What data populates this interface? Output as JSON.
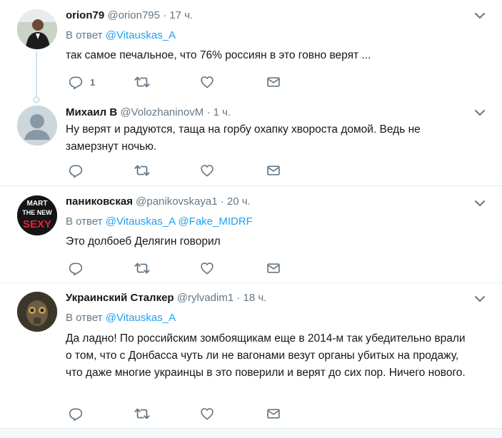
{
  "tweets": [
    {
      "name": "orion79",
      "handle": "@orion795",
      "time": "· 17 ч.",
      "reply_prefix": "В ответ",
      "mentions": "@Vitauskas_A",
      "text": "так самое печальное, что 76% россиян в это говно верят ...",
      "reply_count": "1"
    },
    {
      "name": "Михаил В",
      "handle": "@VolozhaninovM",
      "time": "· 1 ч.",
      "text": "Ну верят и радуются, таща на горбу охапку хвороста домой. Ведь не замерзнут ночью."
    },
    {
      "name": "паниковская",
      "handle": "@panikovskaya1",
      "time": "· 20 ч.",
      "reply_prefix": "В ответ",
      "mentions": "@Vitauskas_A @Fake_MIDRF",
      "text": "Это долбоеб Делягин говорил",
      "avatar_text_1": "MART",
      "avatar_text_2": "THE NEW",
      "avatar_text_3": "SEXY"
    },
    {
      "name": "Украинский Сталкер",
      "handle": "@rylvadim1",
      "time": "· 18 ч.",
      "reply_prefix": "В ответ",
      "mentions": "@Vitauskas_A",
      "text": "Да ладно! По российским зомбоящикам еще в 2014-м так убедительно врали о том, что с Донбасса чуть ли не вагонами везут органы убитых на продажу, что даже многие украинцы в это поверили и верят до сих пор. Ничего нового."
    }
  ],
  "icons": {
    "reply": "reply-icon",
    "retweet": "retweet-icon",
    "like": "heart-icon",
    "dm": "envelope-icon",
    "caret": "chevron-down-icon"
  },
  "colors": {
    "link": "#1da1f2",
    "muted": "#657786",
    "text": "#14171a",
    "separator": "#e6ecf0",
    "thread": "#cfe3f2"
  }
}
